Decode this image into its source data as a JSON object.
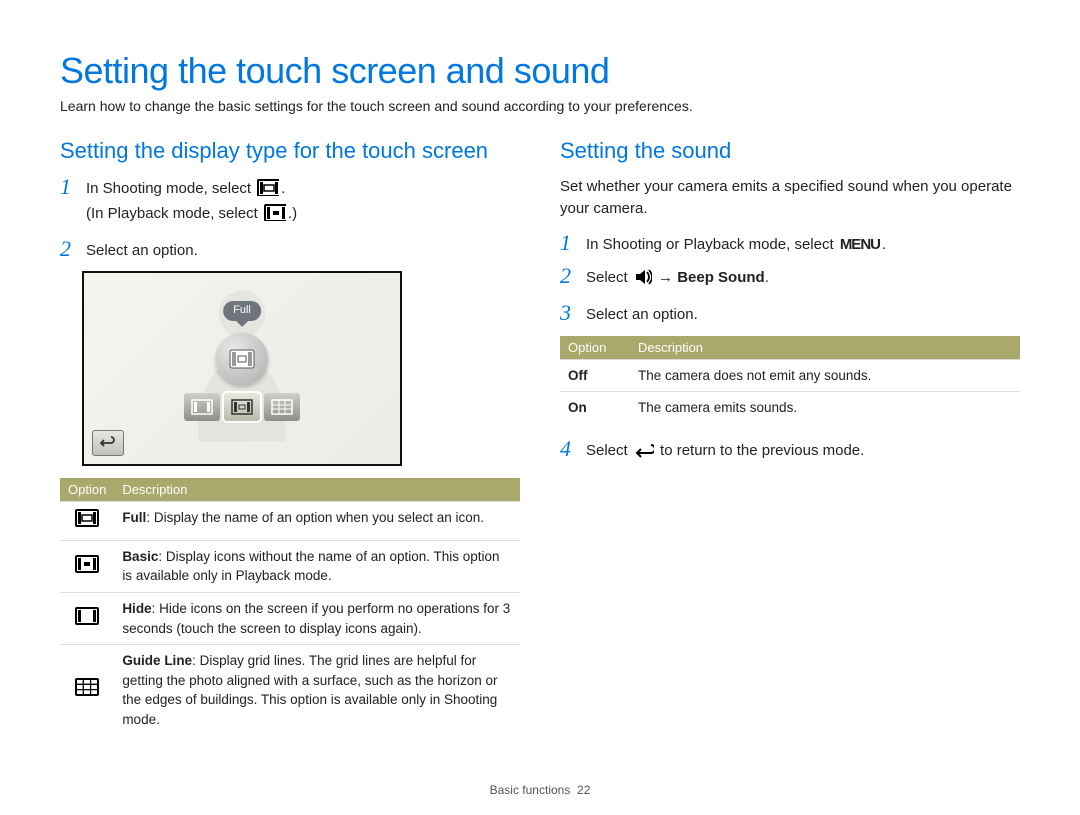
{
  "page": {
    "title": "Setting the touch screen and sound",
    "intro": "Learn how to change the basic settings for the touch screen and sound according to your preferences.",
    "footer_section": "Basic functions",
    "footer_page": "22"
  },
  "left": {
    "heading": "Setting the display type for the touch screen",
    "steps": {
      "s1a": "In Shooting mode, select ",
      "s1b": "(In Playback mode, select ",
      "s1c": ".)",
      "s2": "Select an option."
    },
    "screen": {
      "bubble": "Full"
    },
    "table": {
      "h1": "Option",
      "h2": "Description",
      "rows": {
        "full": {
          "name": "Full",
          "desc": ": Display the name of an option when you select an icon."
        },
        "basic": {
          "name": "Basic",
          "desc": ": Display icons without the name of an option. This option is available only in Playback mode."
        },
        "hide": {
          "name": "Hide",
          "desc": ": Hide icons on the screen if you perform no operations for 3 seconds (touch the screen to display icons again)."
        },
        "guide": {
          "name": "Guide Line",
          "desc": ": Display grid lines. The grid lines are helpful for getting the photo aligned with a surface, such as the horizon or the edges of buildings. This option is available only in Shooting mode."
        }
      }
    }
  },
  "right": {
    "heading": "Setting the sound",
    "intro": "Set whether your camera emits a specified sound when you operate your camera.",
    "steps": {
      "s1": "In Shooting or Playback mode, select ",
      "s2a": "Select ",
      "s2b": " → ",
      "s2c": "Beep Sound",
      "s2d": ".",
      "s3": "Select an option.",
      "s4a": "Select ",
      "s4b": " to return to the previous mode."
    },
    "table": {
      "h1": "Option",
      "h2": "Description",
      "rows": {
        "off": {
          "name": "Off",
          "desc": "The camera does not emit any sounds."
        },
        "on": {
          "name": "On",
          "desc": "The camera emits sounds."
        }
      }
    }
  },
  "icons": {
    "menu_label": "MENU"
  }
}
